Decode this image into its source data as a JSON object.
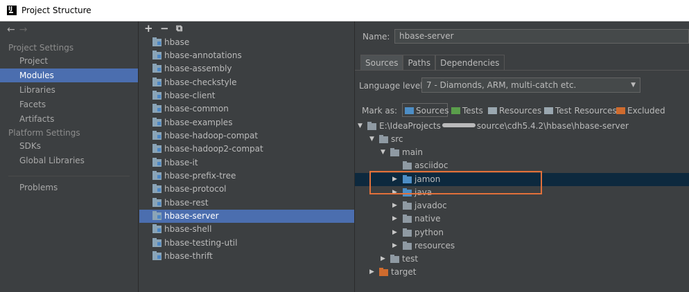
{
  "window": {
    "title": "Project Structure"
  },
  "nav": {
    "back": "←",
    "forward": "→"
  },
  "left_panel": {
    "project_settings_title": "Project Settings",
    "project_settings_items": [
      "Project",
      "Modules",
      "Libraries",
      "Facets",
      "Artifacts"
    ],
    "platform_settings_title": "Platform Settings",
    "platform_settings_items": [
      "SDKs",
      "Global Libraries"
    ],
    "problems": "Problems",
    "selected": "Modules"
  },
  "toolbar": {
    "add": "+",
    "remove": "−",
    "copy": "⧉"
  },
  "modules": [
    "hbase",
    "hbase-annotations",
    "hbase-assembly",
    "hbase-checkstyle",
    "hbase-client",
    "hbase-common",
    "hbase-examples",
    "hbase-hadoop-compat",
    "hbase-hadoop2-compat",
    "hbase-it",
    "hbase-prefix-tree",
    "hbase-protocol",
    "hbase-rest",
    "hbase-server",
    "hbase-shell",
    "hbase-testing-util",
    "hbase-thrift"
  ],
  "selected_module": "hbase-server",
  "details": {
    "name_label": "Name:",
    "name_value": "hbase-server",
    "tabs": [
      "Sources",
      "Paths",
      "Dependencies"
    ],
    "active_tab": "Sources",
    "language_label": "Language level:",
    "language_value": "7 - Diamonds, ARM, multi-catch etc.",
    "mark_as_label": "Mark as:",
    "mark_as": [
      {
        "label": "Sources",
        "color": "#4d8ec6"
      },
      {
        "label": "Tests",
        "color": "#5a9e4b"
      },
      {
        "label": "Resources",
        "color": "#9aa7b0"
      },
      {
        "label": "Test Resources",
        "color": "#9aa7b0"
      },
      {
        "label": "Excluded",
        "color": "#cf6b2e"
      }
    ]
  },
  "tree": {
    "root_prefix": "E:\\IdeaProjects",
    "root_suffix": "source\\cdh5.4.2\\hbase\\hbase-server",
    "nodes": [
      "src",
      "main",
      "asciidoc",
      "jamon",
      "java",
      "javadoc",
      "native",
      "python",
      "resources",
      "test",
      "target"
    ]
  },
  "colors": {
    "accent": "#4b6eaf",
    "tree_selected": "#0d293e",
    "highlight": "#e2703a",
    "source_folder": "#4d8ec6",
    "excluded_folder": "#cf6b2e"
  }
}
